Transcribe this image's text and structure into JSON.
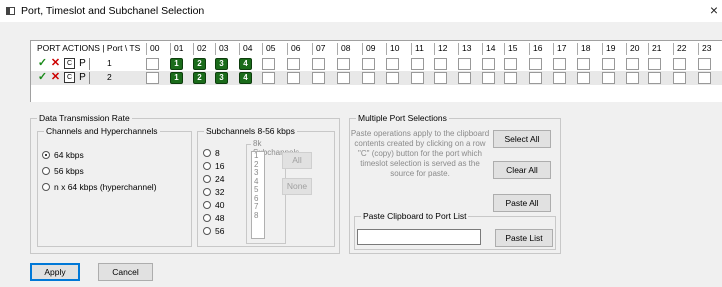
{
  "window": {
    "title": "Port, Timeslot and Subchanel Selection",
    "close_glyph": "×"
  },
  "grid": {
    "header_actions": "PORT ACTIONS  |   Port \\ TS",
    "timeslots": [
      "00",
      "01",
      "02",
      "03",
      "04",
      "05",
      "06",
      "07",
      "08",
      "09",
      "10",
      "11",
      "12",
      "13",
      "14",
      "15",
      "16",
      "17",
      "18",
      "19",
      "20",
      "21",
      "22",
      "23"
    ],
    "rows": [
      {
        "port": "1",
        "on": {
          "01": "1",
          "02": "2",
          "03": "3",
          "04": "4"
        }
      },
      {
        "port": "2",
        "on": {
          "01": "1",
          "02": "2",
          "03": "3",
          "04": "4"
        }
      }
    ],
    "icons": {
      "apply": "✓",
      "clear": "✕",
      "copy": "C",
      "paste": "P"
    }
  },
  "data_rate": {
    "legend": "Data Transmission Rate",
    "channels_legend": "Channels and Hyperchannels",
    "options": [
      "64 kbps",
      "56 kbps",
      "n x 64 kbps (hyperchannel)"
    ],
    "selected_index": 0
  },
  "subchannels": {
    "legend": "Subchannels 8-56 kbps",
    "options": [
      "8",
      "16",
      "24",
      "32",
      "40",
      "48",
      "56"
    ],
    "list_legend": "8k Subchannels",
    "list_items": [
      "1",
      "2",
      "3",
      "4",
      "5",
      "6",
      "7",
      "8"
    ],
    "all_label": "All",
    "none_label": "None"
  },
  "multi": {
    "legend": "Multiple Port Selections",
    "description": "Paste operations apply to the clipboard contents created by clicking on a row \"C\" (copy) button for the port which timeslot selection is served as the source for paste.",
    "select_all": "Select All",
    "clear_all": "Clear All",
    "paste_all": "Paste All",
    "clipboard_legend": "Paste Clipboard to Port List",
    "clipboard_value": "",
    "paste_list": "Paste List"
  },
  "footer": {
    "apply": "Apply",
    "cancel": "Cancel"
  }
}
